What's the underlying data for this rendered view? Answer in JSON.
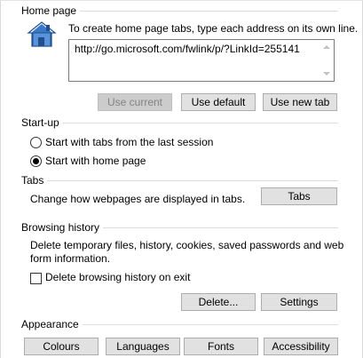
{
  "home_page": {
    "group_label": "Home page",
    "description": "To create home page tabs, type each address on its own line.",
    "url": "http://go.microsoft.com/fwlink/p/?LinkId=255141",
    "icon": "home-page-icon",
    "buttons": {
      "use_current": "Use current",
      "use_default": "Use default",
      "use_new_tab": "Use new tab"
    }
  },
  "startup": {
    "group_label": "Start-up",
    "options": [
      {
        "label": "Start with tabs from the last session",
        "selected": false
      },
      {
        "label": "Start with home page",
        "selected": true
      }
    ]
  },
  "tabs": {
    "group_label": "Tabs",
    "description": "Change how webpages are displayed in tabs.",
    "button": "Tabs"
  },
  "browsing_history": {
    "group_label": "Browsing history",
    "description_line1": "Delete temporary files, history, cookies, saved passwords and web",
    "description_line2": "form information.",
    "checkbox_label": "Delete browsing history on exit",
    "checkbox_checked": false,
    "buttons": {
      "delete": "Delete...",
      "settings": "Settings"
    }
  },
  "appearance": {
    "group_label": "Appearance",
    "buttons": {
      "colours": "Colours",
      "languages": "Languages",
      "fonts": "Fonts",
      "accessibility": "Accessibility"
    }
  },
  "colors": {
    "button_face": "#e1e1e1",
    "button_border": "#adadad",
    "disabled_text": "#838383",
    "house_blue": "#2f6fc1"
  }
}
